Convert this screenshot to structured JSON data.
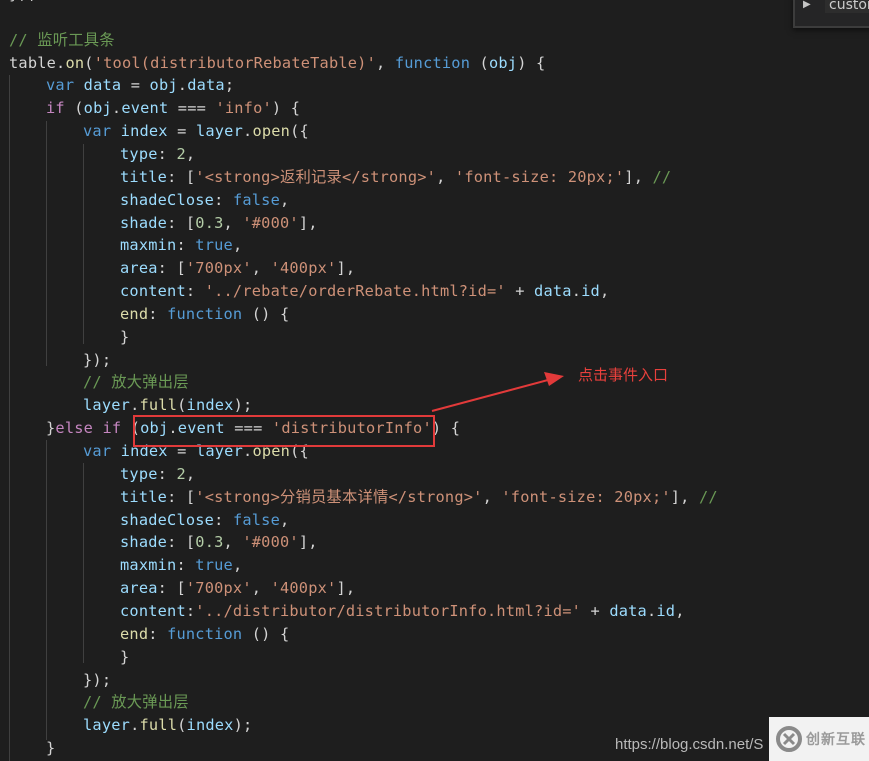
{
  "outline": {
    "label": "custom",
    "chevron_icon": "chevron-right-icon"
  },
  "code_lines": [
    {
      "indent": 0,
      "tokens": [
        [
          "pl",
          "});"
        ]
      ]
    },
    {
      "indent": 0,
      "tokens": []
    },
    {
      "indent": 0,
      "tokens": [
        [
          "cm",
          "// 监听工具条"
        ]
      ]
    },
    {
      "indent": 0,
      "tokens": [
        [
          "pl",
          "table."
        ],
        [
          "fn",
          "on"
        ],
        [
          "pl",
          "("
        ],
        [
          "str",
          "'tool(distributorRebateTable)'"
        ],
        [
          "pl",
          ", "
        ],
        [
          "kw",
          "function"
        ],
        [
          "pl",
          " ("
        ],
        [
          "prop",
          "obj"
        ],
        [
          "pl",
          ") {"
        ]
      ]
    },
    {
      "indent": 1,
      "tokens": [
        [
          "kw",
          "var"
        ],
        [
          "pl",
          " "
        ],
        [
          "prop",
          "data"
        ],
        [
          "pl",
          " = "
        ],
        [
          "prop",
          "obj"
        ],
        [
          "pl",
          "."
        ],
        [
          "prop",
          "data"
        ],
        [
          "pl",
          ";"
        ]
      ]
    },
    {
      "indent": 1,
      "tokens": [
        [
          "kw2",
          "if"
        ],
        [
          "pl",
          " ("
        ],
        [
          "prop",
          "obj"
        ],
        [
          "pl",
          "."
        ],
        [
          "prop",
          "event"
        ],
        [
          "pl",
          " === "
        ],
        [
          "str",
          "'info'"
        ],
        [
          "pl",
          ") {"
        ]
      ]
    },
    {
      "indent": 2,
      "tokens": [
        [
          "kw",
          "var"
        ],
        [
          "pl",
          " "
        ],
        [
          "prop",
          "index"
        ],
        [
          "pl",
          " = "
        ],
        [
          "prop",
          "layer"
        ],
        [
          "pl",
          "."
        ],
        [
          "fn",
          "open"
        ],
        [
          "pl",
          "({"
        ]
      ]
    },
    {
      "indent": 3,
      "tokens": [
        [
          "prop",
          "type"
        ],
        [
          "pl",
          ": "
        ],
        [
          "num",
          "2"
        ],
        [
          "pl",
          ","
        ]
      ]
    },
    {
      "indent": 3,
      "tokens": [
        [
          "prop",
          "title"
        ],
        [
          "pl",
          ": ["
        ],
        [
          "str",
          "'<strong>返利记录</strong>'"
        ],
        [
          "pl",
          ", "
        ],
        [
          "str",
          "'font-size: 20px;'"
        ],
        [
          "pl",
          "], "
        ],
        [
          "cm",
          "//"
        ]
      ]
    },
    {
      "indent": 3,
      "tokens": [
        [
          "prop",
          "shadeClose"
        ],
        [
          "pl",
          ": "
        ],
        [
          "kw",
          "false"
        ],
        [
          "pl",
          ","
        ]
      ]
    },
    {
      "indent": 3,
      "tokens": [
        [
          "prop",
          "shade"
        ],
        [
          "pl",
          ": ["
        ],
        [
          "num",
          "0.3"
        ],
        [
          "pl",
          ", "
        ],
        [
          "str",
          "'#000'"
        ],
        [
          "pl",
          "],"
        ]
      ]
    },
    {
      "indent": 3,
      "tokens": [
        [
          "prop",
          "maxmin"
        ],
        [
          "pl",
          ": "
        ],
        [
          "kw",
          "true"
        ],
        [
          "pl",
          ","
        ]
      ]
    },
    {
      "indent": 3,
      "tokens": [
        [
          "prop",
          "area"
        ],
        [
          "pl",
          ": ["
        ],
        [
          "str",
          "'700px'"
        ],
        [
          "pl",
          ", "
        ],
        [
          "str",
          "'400px'"
        ],
        [
          "pl",
          "],"
        ]
      ]
    },
    {
      "indent": 3,
      "tokens": [
        [
          "prop",
          "content"
        ],
        [
          "pl",
          ": "
        ],
        [
          "str",
          "'../rebate/orderRebate.html?id='"
        ],
        [
          "pl",
          " + "
        ],
        [
          "prop",
          "data"
        ],
        [
          "pl",
          "."
        ],
        [
          "prop",
          "id"
        ],
        [
          "pl",
          ","
        ]
      ]
    },
    {
      "indent": 3,
      "tokens": [
        [
          "fn",
          "end"
        ],
        [
          "pl",
          ": "
        ],
        [
          "kw",
          "function"
        ],
        [
          "pl",
          " () {"
        ]
      ]
    },
    {
      "indent": 3,
      "tokens": [
        [
          "pl",
          "}"
        ]
      ]
    },
    {
      "indent": 2,
      "tokens": [
        [
          "pl",
          "});"
        ]
      ]
    },
    {
      "indent": 2,
      "tokens": [
        [
          "cm",
          "// 放大弹出层"
        ]
      ]
    },
    {
      "indent": 2,
      "tokens": [
        [
          "prop",
          "layer"
        ],
        [
          "pl",
          "."
        ],
        [
          "fn",
          "full"
        ],
        [
          "pl",
          "("
        ],
        [
          "prop",
          "index"
        ],
        [
          "pl",
          ");"
        ]
      ]
    },
    {
      "indent": 1,
      "tokens": [
        [
          "pl",
          "}"
        ],
        [
          "kw2",
          "else if"
        ],
        [
          "pl",
          " ("
        ],
        [
          "prop",
          "obj"
        ],
        [
          "pl",
          "."
        ],
        [
          "prop",
          "event"
        ],
        [
          "pl",
          " === "
        ],
        [
          "str",
          "'distributorInfo'"
        ],
        [
          "pl",
          ") {"
        ]
      ]
    },
    {
      "indent": 2,
      "tokens": [
        [
          "kw",
          "var"
        ],
        [
          "pl",
          " "
        ],
        [
          "prop",
          "index"
        ],
        [
          "pl",
          " = "
        ],
        [
          "prop",
          "layer"
        ],
        [
          "pl",
          "."
        ],
        [
          "fn",
          "open"
        ],
        [
          "pl",
          "({"
        ]
      ]
    },
    {
      "indent": 3,
      "tokens": [
        [
          "prop",
          "type"
        ],
        [
          "pl",
          ": "
        ],
        [
          "num",
          "2"
        ],
        [
          "pl",
          ","
        ]
      ]
    },
    {
      "indent": 3,
      "tokens": [
        [
          "prop",
          "title"
        ],
        [
          "pl",
          ": ["
        ],
        [
          "str",
          "'<strong>分销员基本详情</strong>'"
        ],
        [
          "pl",
          ", "
        ],
        [
          "str",
          "'font-size: 20px;'"
        ],
        [
          "pl",
          "], "
        ],
        [
          "cm",
          "//"
        ]
      ]
    },
    {
      "indent": 3,
      "tokens": [
        [
          "prop",
          "shadeClose"
        ],
        [
          "pl",
          ": "
        ],
        [
          "kw",
          "false"
        ],
        [
          "pl",
          ","
        ]
      ]
    },
    {
      "indent": 3,
      "tokens": [
        [
          "prop",
          "shade"
        ],
        [
          "pl",
          ": ["
        ],
        [
          "num",
          "0.3"
        ],
        [
          "pl",
          ", "
        ],
        [
          "str",
          "'#000'"
        ],
        [
          "pl",
          "],"
        ]
      ]
    },
    {
      "indent": 3,
      "tokens": [
        [
          "prop",
          "maxmin"
        ],
        [
          "pl",
          ": "
        ],
        [
          "kw",
          "true"
        ],
        [
          "pl",
          ","
        ]
      ]
    },
    {
      "indent": 3,
      "tokens": [
        [
          "prop",
          "area"
        ],
        [
          "pl",
          ": ["
        ],
        [
          "str",
          "'700px'"
        ],
        [
          "pl",
          ", "
        ],
        [
          "str",
          "'400px'"
        ],
        [
          "pl",
          "],"
        ]
      ]
    },
    {
      "indent": 3,
      "tokens": [
        [
          "prop",
          "content"
        ],
        [
          "pl",
          ":"
        ],
        [
          "str",
          "'../distributor/distributorInfo.html?id='"
        ],
        [
          "pl",
          " + "
        ],
        [
          "prop",
          "data"
        ],
        [
          "pl",
          "."
        ],
        [
          "prop",
          "id"
        ],
        [
          "pl",
          ","
        ]
      ]
    },
    {
      "indent": 3,
      "tokens": [
        [
          "fn",
          "end"
        ],
        [
          "pl",
          ": "
        ],
        [
          "kw",
          "function"
        ],
        [
          "pl",
          " () {"
        ]
      ]
    },
    {
      "indent": 3,
      "tokens": [
        [
          "pl",
          "}"
        ]
      ]
    },
    {
      "indent": 2,
      "tokens": [
        [
          "pl",
          "});"
        ]
      ]
    },
    {
      "indent": 2,
      "tokens": [
        [
          "cm",
          "// 放大弹出层"
        ]
      ]
    },
    {
      "indent": 2,
      "tokens": [
        [
          "prop",
          "layer"
        ],
        [
          "pl",
          "."
        ],
        [
          "fn",
          "full"
        ],
        [
          "pl",
          "("
        ],
        [
          "prop",
          "index"
        ],
        [
          "pl",
          ");"
        ]
      ]
    },
    {
      "indent": 1,
      "tokens": [
        [
          "pl",
          "}"
        ]
      ]
    }
  ],
  "annotation": {
    "label": "点击事件入口",
    "highlighted_code": "obj.event === 'distributorInfo'",
    "color": "#e23a3a"
  },
  "watermark": {
    "url": "https://blog.csdn.net/S",
    "logo_text": "创新互联"
  }
}
